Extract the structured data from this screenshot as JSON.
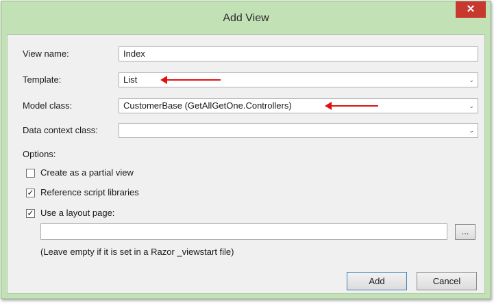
{
  "window": {
    "title": "Add View",
    "close_glyph": "✕"
  },
  "fields": {
    "view_name": {
      "label": "View name:",
      "value": "Index"
    },
    "template": {
      "label": "Template:",
      "value": "List"
    },
    "model_class": {
      "label": "Model class:",
      "value": "CustomerBase (GetAllGetOne.Controllers)"
    },
    "data_context_class": {
      "label": "Data context class:",
      "value": ""
    }
  },
  "options": {
    "heading": "Options:",
    "partial_view": {
      "label": "Create as a partial view",
      "checked": false
    },
    "reference_scripts": {
      "label": "Reference script libraries",
      "checked": true
    },
    "layout_page": {
      "label": "Use a layout page:",
      "checked": true
    },
    "layout_path": "",
    "browse_label": "...",
    "hint": "(Leave empty if it is set in a Razor _viewstart file)"
  },
  "buttons": {
    "add": "Add",
    "cancel": "Cancel"
  },
  "colors": {
    "frame": "#c2e2b6",
    "close": "#c7392f",
    "annotation_arrow": "#e01010"
  }
}
